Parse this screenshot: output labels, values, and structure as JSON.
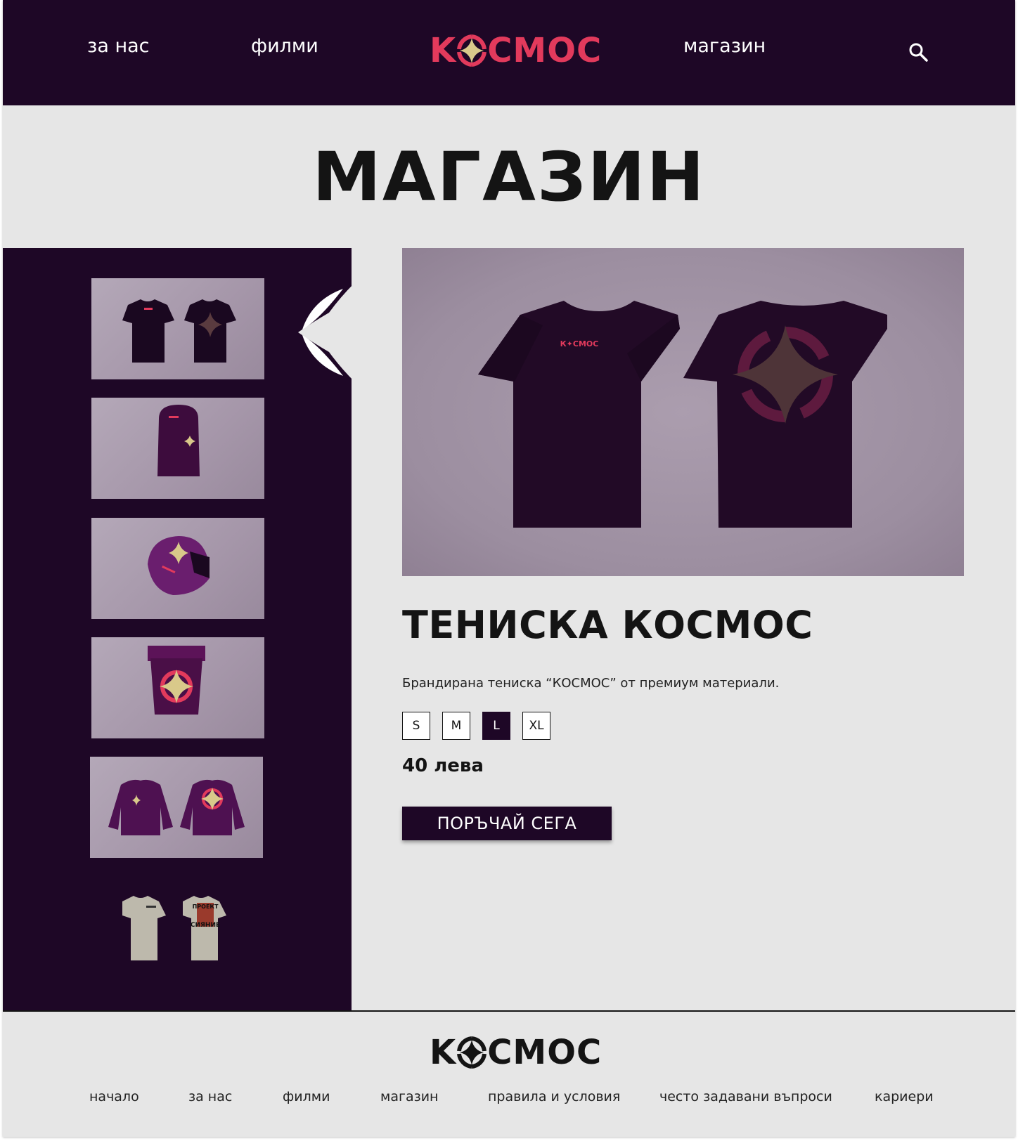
{
  "header": {
    "nav": {
      "about": "за нас",
      "films": "филми",
      "shop": "магазин"
    },
    "logo": {
      "left": "K",
      "right": "СМОС"
    },
    "search_icon": "search-icon"
  },
  "page_title": "МАГАЗИН",
  "gallery": {
    "items": [
      "tshirt-dark",
      "balaclava",
      "helmet",
      "backpack",
      "puffer-jacket",
      "tshirt-light-project"
    ],
    "tshirt_light_print": {
      "line1": "ПРОЕКТ",
      "line2": "СИЯНИЕ"
    }
  },
  "product": {
    "title": "ТЕНИСКА КОСМОС",
    "description": "Брандирана тениска “КОСМОС” от премиум материали.",
    "sizes": [
      "S",
      "M",
      "L",
      "XL"
    ],
    "selected_size": "L",
    "price": "40 лева",
    "order_label": "ПОРЪЧАЙ СЕГА",
    "shirt_logo": "К✦СМОС"
  },
  "footer": {
    "logo": {
      "left": "K",
      "right": "СМОС"
    },
    "links": [
      "начало",
      "за нас",
      "филми",
      "магазин",
      "правила и условия",
      "често задавани въпроси",
      "кариери"
    ]
  },
  "colors": {
    "brand_dark": "#1e0726",
    "brand_red": "#e23a5c",
    "brand_gold": "#d9c98a",
    "background": "#e6e6e6"
  }
}
